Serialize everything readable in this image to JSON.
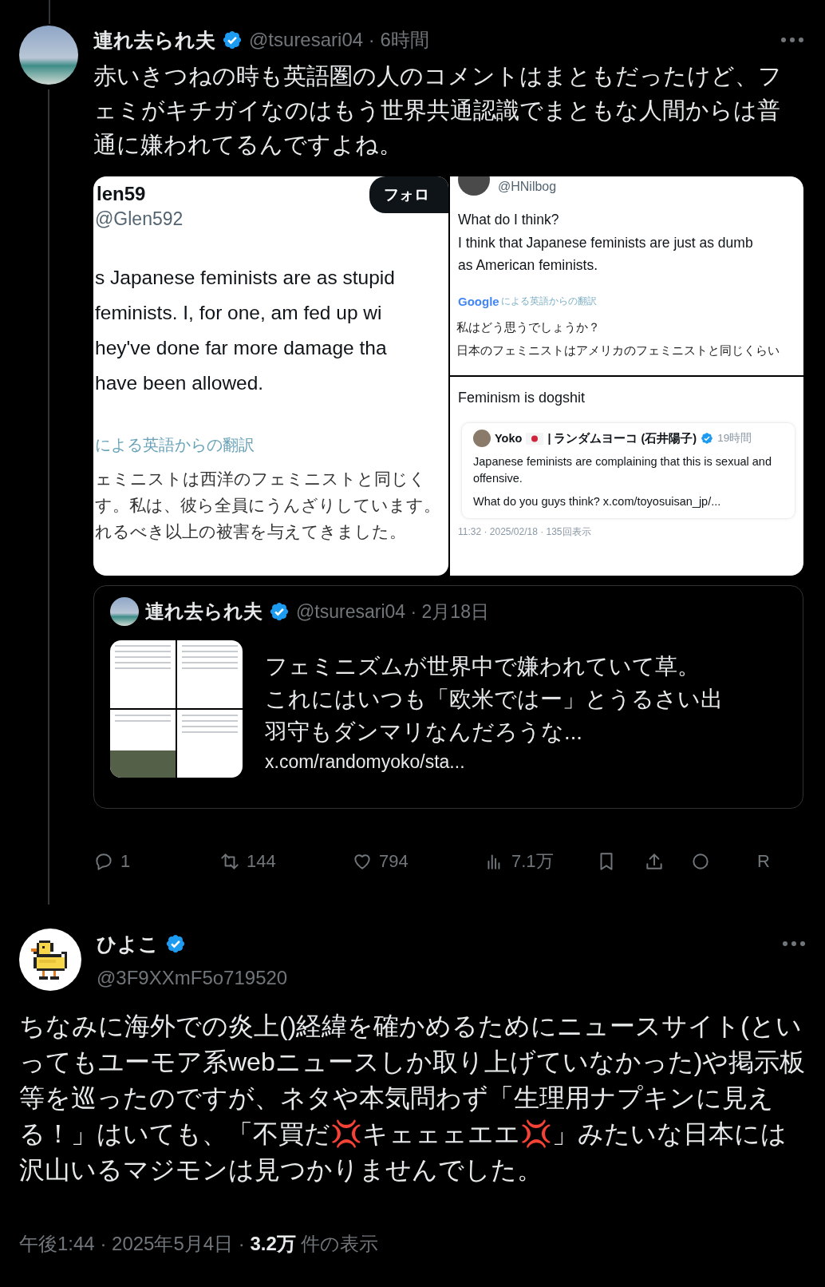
{
  "post": {
    "name": "連れ去られ夫",
    "verified": true,
    "handle_time": "@tsuresari04 · 6時間",
    "text": "赤いきつねの時も英語圏の人のコメントはまともだったけど、フェミがキチガイなのはもう世界共通認識でまともな人間からは普通に嫌われてるんですよね。",
    "media": {
      "left": {
        "name": "len59",
        "handle": "@Glen592",
        "follow": "フォロ",
        "lines": [
          "s Japanese feminists are as stupid",
          "feminists. I, for one, am fed up wi",
          "hey've done far more damage tha",
          "have been allowed."
        ],
        "translation_label": "による英語からの翻訳",
        "translated_lines": [
          "ェミニストは西洋のフェミニストと同じく",
          "す。私は、彼ら全員にうんざりしています。",
          "れるべき以上の被害を与えてきました。"
        ]
      },
      "right_top": {
        "handle": "@HNilbog",
        "lines": [
          "What do I think?",
          "I think that Japanese feminists are just as dumb",
          "as American feminists."
        ],
        "translation_brand": "Google",
        "translation_label": "による英語からの翻訳",
        "translated_lines": [
          "私はどう思うでしょうか？",
          "日本のフェミニストはアメリカのフェミニストと同じくらい"
        ]
      },
      "right_bottom": {
        "text": "Feminism is dogshit",
        "embed": {
          "name": "Yoko",
          "display": "| ランダムヨーコ (石井陽子)",
          "verified": true,
          "time": "19時間",
          "paragraphs": [
            "Japanese feminists are complaining that this is sexual and offensive.",
            "What do you guys think? x.com/toyosuisan_jp/..."
          ]
        },
        "footer": "11:32 · 2025/02/18 · 135回表示"
      }
    },
    "quote": {
      "name": "連れ去られ夫",
      "verified": true,
      "handle_time": "@tsuresari04 · 2月18日",
      "lines": [
        "フェミニズムが世界中で嫌われていて草。",
        "これにはいつも「欧米ではー」とうるさい出羽守もダンマリなんだろうな..."
      ],
      "link": "x.com/randomyoko/sta..."
    },
    "actions": [
      {
        "kind": "reply",
        "count": "1"
      },
      {
        "kind": "repost",
        "count": "144"
      },
      {
        "kind": "like",
        "count": "794"
      },
      {
        "kind": "views",
        "count": "7.1万"
      },
      {
        "kind": "bookmark"
      },
      {
        "kind": "share"
      },
      {
        "kind": "circle"
      },
      {
        "kind": "letter",
        "label": "R"
      }
    ]
  },
  "reply": {
    "name": "ひよこ",
    "verified": true,
    "handle": "@3F9XXmF5o719520",
    "text": "ちなみに海外での炎上()経緯を確かめるためにニュースサイト(といってもユーモア系webニュースしか取り上げていなかった)や掲示板等を巡ったのですが、ネタや本気問わず「生理用ナプキンに見える！」はいても、「不買だ💢キェェェエエ💢」みたいな日本には沢山いるマジモンは見つかりませんでした。",
    "footer": "午後1:44 · 2025年5月4日 · **3.2万** 件の表示"
  }
}
